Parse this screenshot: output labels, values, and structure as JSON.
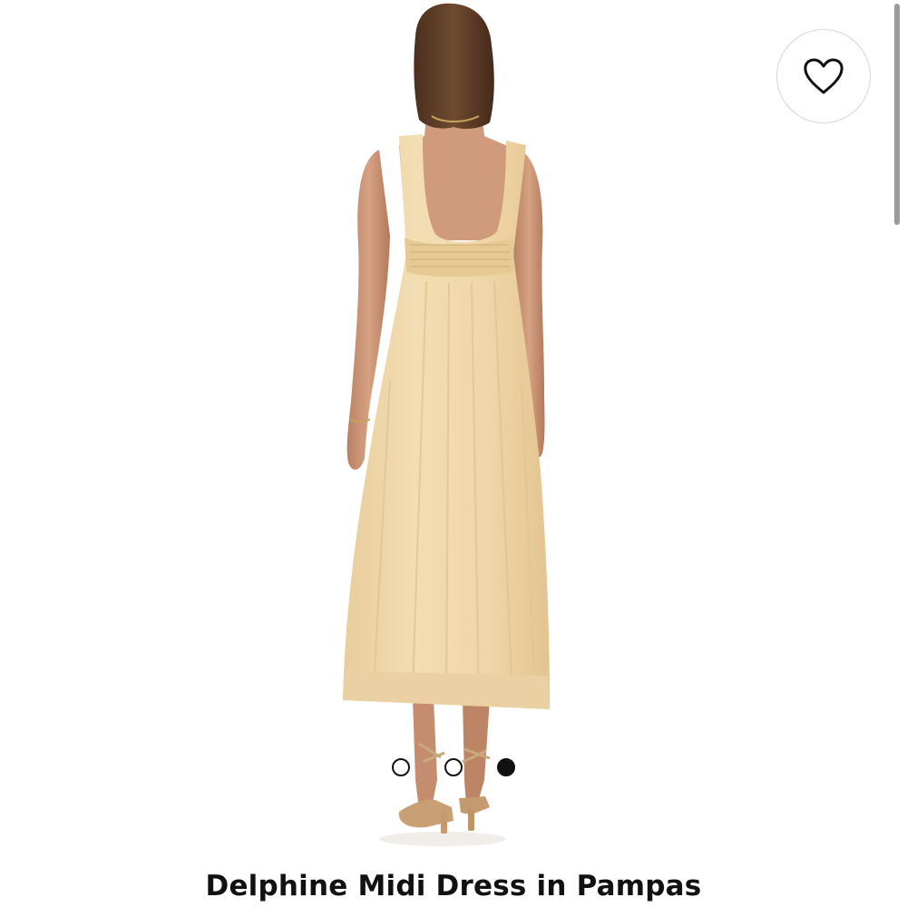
{
  "product": {
    "title": "Delphine Midi Dress in Pampas",
    "image_alt": "Model wearing sleeveless square-back midi dress in pampas, back view"
  },
  "wishlist": {
    "icon": "heart-outline-icon"
  },
  "carousel": {
    "total": 3,
    "active_index": 2
  },
  "colors": {
    "dress": "#efd8ad",
    "skin": "#c99572",
    "hair": "#5a3b26",
    "accent": "#111111"
  }
}
